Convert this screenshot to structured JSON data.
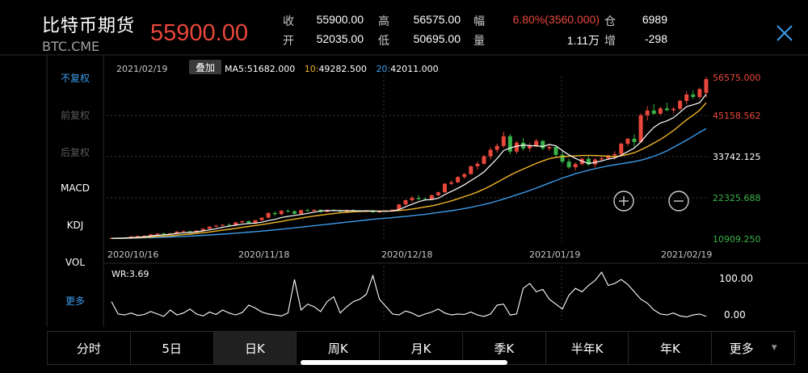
{
  "header": {
    "title": "比特币期货",
    "symbol": "BTC.CME",
    "price": "55900.00",
    "stats": [
      [
        {
          "label": "收",
          "value": "55900.00"
        },
        {
          "label": "高",
          "value": "56575.00"
        },
        {
          "label": "幅",
          "value": "6.80%(3560.000)",
          "accent": true
        },
        {
          "label": "仓",
          "value": "6989"
        }
      ],
      [
        {
          "label": "开",
          "value": "52035.00"
        },
        {
          "label": "低",
          "value": "50695.00"
        },
        {
          "label": "量",
          "value": "1.11万"
        },
        {
          "label": "增",
          "value": "-298"
        }
      ]
    ]
  },
  "side_menu": {
    "items": [
      {
        "label": "不复权",
        "state": "active"
      },
      {
        "label": "前复权",
        "state": "disabled"
      },
      {
        "label": "后复权",
        "state": "disabled"
      },
      {
        "label": "MACD",
        "state": "normal"
      },
      {
        "label": "KDJ",
        "state": "normal"
      },
      {
        "label": "VOL",
        "state": "normal"
      },
      {
        "label": "更多",
        "state": "active"
      }
    ]
  },
  "chart_info": {
    "date": "2021/02/19",
    "overlay_label": "叠加",
    "ma": [
      {
        "label": "MA5:",
        "value": "51682.000",
        "color": "#ffffff"
      },
      {
        "label": "10:",
        "value": "49282.500",
        "color": "#f0b429"
      },
      {
        "label": "20:",
        "value": "42011.000",
        "color": "#3d9be9"
      }
    ],
    "y_labels": [
      {
        "text": "56575.000",
        "color": "#e8473b"
      },
      {
        "text": "45158.562",
        "color": "#e8473b"
      },
      {
        "text": "33742.125",
        "color": "#ffffff"
      },
      {
        "text": "22325.688",
        "color": "#3bb34a"
      },
      {
        "text": "10909.250",
        "color": "#3bb34a"
      }
    ],
    "x_labels": [
      "2020/10/16",
      "2020/11/18",
      "2020/12/18",
      "2021/01/19",
      "2021/02/19"
    ],
    "wr_label": "WR:3.69",
    "wr_ticks": [
      "100.00",
      "0.00"
    ],
    "zoom_in_icon": "plus-circle-icon",
    "zoom_out_icon": "minus-circle-icon"
  },
  "tabs": [
    {
      "label": "分时"
    },
    {
      "label": "5日"
    },
    {
      "label": "日K",
      "active": true
    },
    {
      "label": "周K"
    },
    {
      "label": "月K"
    },
    {
      "label": "季K"
    },
    {
      "label": "半年K"
    },
    {
      "label": "年K"
    },
    {
      "label": "更多",
      "dropdown": true
    }
  ],
  "chart_data": {
    "type": "candlestick",
    "ylim": [
      10909.25,
      56575.0
    ],
    "up_color": "#e8473b",
    "down_color": "#3bb34a",
    "candles": [
      [
        11300,
        11500,
        11200,
        11400
      ],
      [
        11400,
        11550,
        11300,
        11350
      ],
      [
        11350,
        11600,
        11300,
        11550
      ],
      [
        11550,
        11900,
        11500,
        11850
      ],
      [
        11850,
        12100,
        11700,
        11950
      ],
      [
        11950,
        12200,
        11850,
        12050
      ],
      [
        12050,
        12500,
        12000,
        12400
      ],
      [
        12400,
        12700,
        12300,
        12650
      ],
      [
        12650,
        12900,
        12400,
        12500
      ],
      [
        12500,
        12800,
        12450,
        12700
      ],
      [
        12700,
        13300,
        12650,
        13200
      ],
      [
        13200,
        13500,
        13000,
        13300
      ],
      [
        13300,
        13400,
        12900,
        13000
      ],
      [
        13000,
        13600,
        12950,
        13500
      ],
      [
        13500,
        14200,
        13400,
        14000
      ],
      [
        14000,
        14700,
        13900,
        14600
      ],
      [
        14600,
        15100,
        14400,
        14900
      ],
      [
        14900,
        15300,
        14700,
        15100
      ],
      [
        15100,
        15500,
        14800,
        14900
      ],
      [
        14900,
        15900,
        14900,
        15800
      ],
      [
        15800,
        16300,
        15500,
        16100
      ],
      [
        16100,
        16300,
        15300,
        15500
      ],
      [
        15500,
        16500,
        15400,
        16400
      ],
      [
        16400,
        17200,
        16300,
        17100
      ],
      [
        17100,
        18700,
        16900,
        18400
      ],
      [
        18400,
        18900,
        17600,
        18100
      ],
      [
        18100,
        19300,
        17800,
        19000
      ],
      [
        19000,
        19400,
        18600,
        18900
      ],
      [
        18900,
        19200,
        18000,
        18200
      ],
      [
        18200,
        19400,
        18000,
        19200
      ],
      [
        19200,
        19600,
        18800,
        19000
      ],
      [
        19000,
        19500,
        18700,
        19300
      ],
      [
        19300,
        19400,
        18500,
        18700
      ],
      [
        18700,
        19400,
        18600,
        19300
      ],
      [
        19300,
        19500,
        18900,
        19100
      ],
      [
        19100,
        19300,
        18500,
        18800
      ],
      [
        18800,
        19400,
        18600,
        19200
      ],
      [
        19200,
        19500,
        18900,
        19100
      ],
      [
        19100,
        19300,
        18700,
        18900
      ],
      [
        18900,
        19200,
        18600,
        19000
      ],
      [
        19000,
        19300,
        18500,
        18600
      ],
      [
        18600,
        19000,
        18400,
        18900
      ],
      [
        18900,
        19200,
        18700,
        19050
      ],
      [
        19050,
        19500,
        18900,
        19350
      ],
      [
        19350,
        21000,
        19200,
        20800
      ],
      [
        20800,
        22200,
        20600,
        22000
      ],
      [
        22000,
        23200,
        21400,
        22600
      ],
      [
        22600,
        23400,
        22000,
        22300
      ],
      [
        22300,
        22800,
        21900,
        22100
      ],
      [
        22100,
        23600,
        22000,
        23400
      ],
      [
        23400,
        24400,
        23100,
        24200
      ],
      [
        24200,
        26800,
        24000,
        26600
      ],
      [
        26600,
        27500,
        26200,
        27000
      ],
      [
        27000,
        28700,
        26800,
        28500
      ],
      [
        28500,
        29600,
        28000,
        29300
      ],
      [
        29300,
        31700,
        29100,
        31500
      ],
      [
        31500,
        32800,
        30600,
        32200
      ],
      [
        32200,
        34700,
        31800,
        34300
      ],
      [
        34300,
        36800,
        33400,
        36100
      ],
      [
        36100,
        37800,
        35300,
        37200
      ],
      [
        37200,
        41200,
        36600,
        39900
      ],
      [
        39900,
        40500,
        34800,
        35600
      ],
      [
        35600,
        38600,
        35000,
        38100
      ],
      [
        38100,
        39400,
        35900,
        36500
      ],
      [
        36500,
        38000,
        35600,
        37200
      ],
      [
        37200,
        39200,
        36800,
        38600
      ],
      [
        38600,
        38800,
        36000,
        36500
      ],
      [
        36500,
        37700,
        35800,
        36900
      ],
      [
        36900,
        37200,
        34200,
        34700
      ],
      [
        34700,
        35800,
        32200,
        32800
      ],
      [
        32800,
        33600,
        30800,
        31200
      ],
      [
        31200,
        32600,
        30400,
        32100
      ],
      [
        32100,
        33900,
        31800,
        33600
      ],
      [
        33600,
        34300,
        31600,
        32000
      ],
      [
        32000,
        33800,
        31200,
        33400
      ],
      [
        33400,
        34200,
        32800,
        33700
      ],
      [
        33700,
        34800,
        33300,
        34500
      ],
      [
        34500,
        35700,
        33400,
        34900
      ],
      [
        34900,
        38200,
        34500,
        37800
      ],
      [
        37800,
        39400,
        37100,
        39200
      ],
      [
        39200,
        40500,
        36900,
        38300
      ],
      [
        38300,
        46300,
        38000,
        45800
      ],
      [
        45800,
        48300,
        44300,
        47100
      ],
      [
        47100,
        48900,
        45900,
        46200
      ],
      [
        46200,
        48200,
        45800,
        47700
      ],
      [
        47700,
        49300,
        46900,
        47200
      ],
      [
        47200,
        48100,
        46400,
        47600
      ],
      [
        47600,
        50200,
        47100,
        49800
      ],
      [
        49800,
        52500,
        48900,
        51600
      ],
      [
        51600,
        52800,
        50300,
        50900
      ],
      [
        50900,
        53500,
        50400,
        53100
      ],
      [
        52035,
        56575,
        50695,
        55900
      ]
    ],
    "ma5": [
      11300,
      11350,
      11383,
      11488,
      11620,
      11740,
      11960,
      12180,
      12320,
      12460,
      12690,
      12870,
      12940,
      13140,
      13400,
      13680,
      14000,
      14420,
      14700,
      15000,
      15280,
      15480,
      15560,
      15840,
      16300,
      16640,
      17160,
      17460,
      17740,
      17980,
      18300,
      18640,
      18980,
      19080,
      19080,
      19060,
      19040,
      19040,
      18960,
      19020,
      18960,
      18900,
      18910,
      18970,
      19390,
      20160,
      20890,
      21580,
      22050,
      22200,
      22540,
      23560,
      24440,
      25340,
      26320,
      27500,
      28640,
      29930,
      31780,
      33660,
      35880,
      36620,
      37100,
      37460,
      37280,
      37220,
      37020,
      37600,
      37200,
      35900,
      34700,
      33700,
      32900,
      32300,
      32600,
      33000,
      33500,
      33800,
      34600,
      35600,
      36600,
      38300,
      40500,
      42400,
      43600,
      44200,
      45100,
      46600,
      48200,
      48700,
      49300,
      51682
    ],
    "ma10": [
      11300,
      11340,
      11360,
      11420,
      11500,
      11600,
      11700,
      11830,
      11950,
      12050,
      12200,
      12350,
      12500,
      12700,
      12900,
      13100,
      13350,
      13600,
      13850,
      14100,
      14400,
      14650,
      14900,
      15150,
      15450,
      15750,
      16050,
      16400,
      16700,
      17000,
      17300,
      17550,
      17800,
      18050,
      18250,
      18450,
      18600,
      18750,
      18850,
      18900,
      18950,
      18950,
      18950,
      18980,
      19100,
      19300,
      19500,
      19800,
      20100,
      20400,
      20800,
      21300,
      21800,
      22400,
      23000,
      23600,
      24300,
      25100,
      26000,
      27000,
      28000,
      29000,
      29900,
      30700,
      31500,
      32300,
      33000,
      33600,
      34000,
      34200,
      34300,
      34400,
      34500,
      34500,
      34500,
      34400,
      34300,
      34200,
      34400,
      34800,
      35300,
      36100,
      37000,
      38000,
      39000,
      40200,
      41500,
      43000,
      44500,
      45800,
      47200,
      49282.5
    ],
    "ma20": [
      11300,
      11320,
      11340,
      11370,
      11410,
      11450,
      11500,
      11560,
      11630,
      11700,
      11780,
      11860,
      11950,
      12050,
      12150,
      12260,
      12380,
      12500,
      12630,
      12760,
      12900,
      13050,
      13200,
      13360,
      13520,
      13700,
      13880,
      14060,
      14250,
      14450,
      14650,
      14850,
      15050,
      15250,
      15450,
      15650,
      15850,
      16050,
      16250,
      16450,
      16650,
      16800,
      16950,
      17100,
      17300,
      17450,
      17650,
      17850,
      18050,
      18300,
      18550,
      18800,
      19050,
      19350,
      19650,
      20000,
      20400,
      20800,
      21250,
      21750,
      22300,
      22900,
      23500,
      24100,
      24700,
      25400,
      26100,
      26800,
      27500,
      28200,
      28800,
      29400,
      29900,
      30400,
      30800,
      31200,
      31600,
      31900,
      32200,
      32500,
      32800,
      33200,
      33700,
      34300,
      35000,
      35800,
      36800,
      37800,
      38800,
      39900,
      41000,
      42011
    ]
  },
  "wr_data": {
    "ylim": [
      0,
      100
    ],
    "values": [
      35,
      10,
      8,
      12,
      7,
      9,
      15,
      10,
      5,
      18,
      8,
      12,
      20,
      10,
      6,
      14,
      9,
      18,
      12,
      8,
      13,
      28,
      22,
      14,
      10,
      8,
      6,
      12,
      80,
      18,
      30,
      25,
      15,
      35,
      45,
      12,
      25,
      35,
      40,
      50,
      88,
      40,
      25,
      10,
      8,
      16,
      12,
      5,
      10,
      14,
      20,
      12,
      8,
      10,
      9,
      14,
      8,
      5,
      10,
      28,
      30,
      8,
      10,
      62,
      72,
      55,
      60,
      40,
      30,
      20,
      48,
      62,
      55,
      68,
      78,
      95,
      68,
      72,
      80,
      70,
      55,
      40,
      32,
      18,
      10,
      8,
      12,
      6,
      4,
      8,
      10,
      5
    ]
  }
}
